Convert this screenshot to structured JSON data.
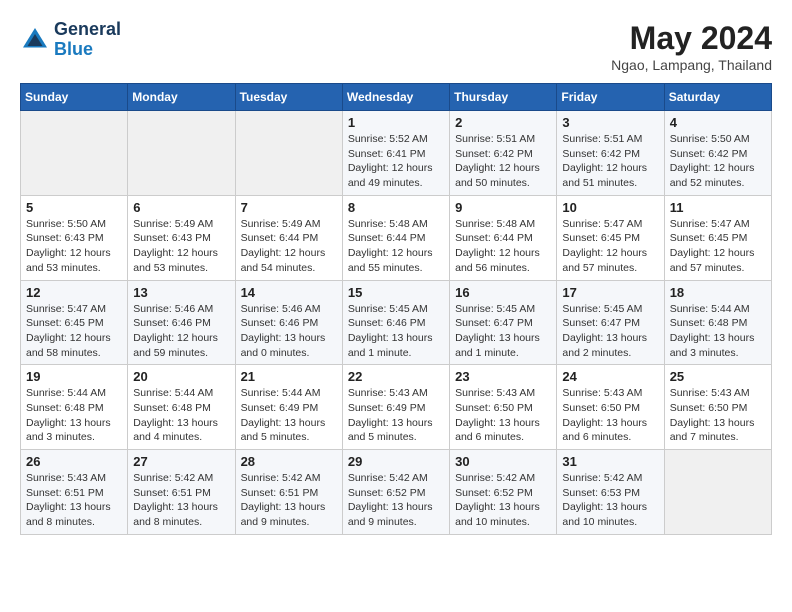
{
  "header": {
    "logo_line1": "General",
    "logo_line2": "Blue",
    "month_year": "May 2024",
    "location": "Ngao, Lampang, Thailand"
  },
  "weekdays": [
    "Sunday",
    "Monday",
    "Tuesday",
    "Wednesday",
    "Thursday",
    "Friday",
    "Saturday"
  ],
  "weeks": [
    [
      {
        "day": "",
        "info": ""
      },
      {
        "day": "",
        "info": ""
      },
      {
        "day": "",
        "info": ""
      },
      {
        "day": "1",
        "info": "Sunrise: 5:52 AM\nSunset: 6:41 PM\nDaylight: 12 hours\nand 49 minutes."
      },
      {
        "day": "2",
        "info": "Sunrise: 5:51 AM\nSunset: 6:42 PM\nDaylight: 12 hours\nand 50 minutes."
      },
      {
        "day": "3",
        "info": "Sunrise: 5:51 AM\nSunset: 6:42 PM\nDaylight: 12 hours\nand 51 minutes."
      },
      {
        "day": "4",
        "info": "Sunrise: 5:50 AM\nSunset: 6:42 PM\nDaylight: 12 hours\nand 52 minutes."
      }
    ],
    [
      {
        "day": "5",
        "info": "Sunrise: 5:50 AM\nSunset: 6:43 PM\nDaylight: 12 hours\nand 53 minutes."
      },
      {
        "day": "6",
        "info": "Sunrise: 5:49 AM\nSunset: 6:43 PM\nDaylight: 12 hours\nand 53 minutes."
      },
      {
        "day": "7",
        "info": "Sunrise: 5:49 AM\nSunset: 6:44 PM\nDaylight: 12 hours\nand 54 minutes."
      },
      {
        "day": "8",
        "info": "Sunrise: 5:48 AM\nSunset: 6:44 PM\nDaylight: 12 hours\nand 55 minutes."
      },
      {
        "day": "9",
        "info": "Sunrise: 5:48 AM\nSunset: 6:44 PM\nDaylight: 12 hours\nand 56 minutes."
      },
      {
        "day": "10",
        "info": "Sunrise: 5:47 AM\nSunset: 6:45 PM\nDaylight: 12 hours\nand 57 minutes."
      },
      {
        "day": "11",
        "info": "Sunrise: 5:47 AM\nSunset: 6:45 PM\nDaylight: 12 hours\nand 57 minutes."
      }
    ],
    [
      {
        "day": "12",
        "info": "Sunrise: 5:47 AM\nSunset: 6:45 PM\nDaylight: 12 hours\nand 58 minutes."
      },
      {
        "day": "13",
        "info": "Sunrise: 5:46 AM\nSunset: 6:46 PM\nDaylight: 12 hours\nand 59 minutes."
      },
      {
        "day": "14",
        "info": "Sunrise: 5:46 AM\nSunset: 6:46 PM\nDaylight: 13 hours\nand 0 minutes."
      },
      {
        "day": "15",
        "info": "Sunrise: 5:45 AM\nSunset: 6:46 PM\nDaylight: 13 hours\nand 1 minute."
      },
      {
        "day": "16",
        "info": "Sunrise: 5:45 AM\nSunset: 6:47 PM\nDaylight: 13 hours\nand 1 minute."
      },
      {
        "day": "17",
        "info": "Sunrise: 5:45 AM\nSunset: 6:47 PM\nDaylight: 13 hours\nand 2 minutes."
      },
      {
        "day": "18",
        "info": "Sunrise: 5:44 AM\nSunset: 6:48 PM\nDaylight: 13 hours\nand 3 minutes."
      }
    ],
    [
      {
        "day": "19",
        "info": "Sunrise: 5:44 AM\nSunset: 6:48 PM\nDaylight: 13 hours\nand 3 minutes."
      },
      {
        "day": "20",
        "info": "Sunrise: 5:44 AM\nSunset: 6:48 PM\nDaylight: 13 hours\nand 4 minutes."
      },
      {
        "day": "21",
        "info": "Sunrise: 5:44 AM\nSunset: 6:49 PM\nDaylight: 13 hours\nand 5 minutes."
      },
      {
        "day": "22",
        "info": "Sunrise: 5:43 AM\nSunset: 6:49 PM\nDaylight: 13 hours\nand 5 minutes."
      },
      {
        "day": "23",
        "info": "Sunrise: 5:43 AM\nSunset: 6:50 PM\nDaylight: 13 hours\nand 6 minutes."
      },
      {
        "day": "24",
        "info": "Sunrise: 5:43 AM\nSunset: 6:50 PM\nDaylight: 13 hours\nand 6 minutes."
      },
      {
        "day": "25",
        "info": "Sunrise: 5:43 AM\nSunset: 6:50 PM\nDaylight: 13 hours\nand 7 minutes."
      }
    ],
    [
      {
        "day": "26",
        "info": "Sunrise: 5:43 AM\nSunset: 6:51 PM\nDaylight: 13 hours\nand 8 minutes."
      },
      {
        "day": "27",
        "info": "Sunrise: 5:42 AM\nSunset: 6:51 PM\nDaylight: 13 hours\nand 8 minutes."
      },
      {
        "day": "28",
        "info": "Sunrise: 5:42 AM\nSunset: 6:51 PM\nDaylight: 13 hours\nand 9 minutes."
      },
      {
        "day": "29",
        "info": "Sunrise: 5:42 AM\nSunset: 6:52 PM\nDaylight: 13 hours\nand 9 minutes."
      },
      {
        "day": "30",
        "info": "Sunrise: 5:42 AM\nSunset: 6:52 PM\nDaylight: 13 hours\nand 10 minutes."
      },
      {
        "day": "31",
        "info": "Sunrise: 5:42 AM\nSunset: 6:53 PM\nDaylight: 13 hours\nand 10 minutes."
      },
      {
        "day": "",
        "info": ""
      }
    ]
  ]
}
